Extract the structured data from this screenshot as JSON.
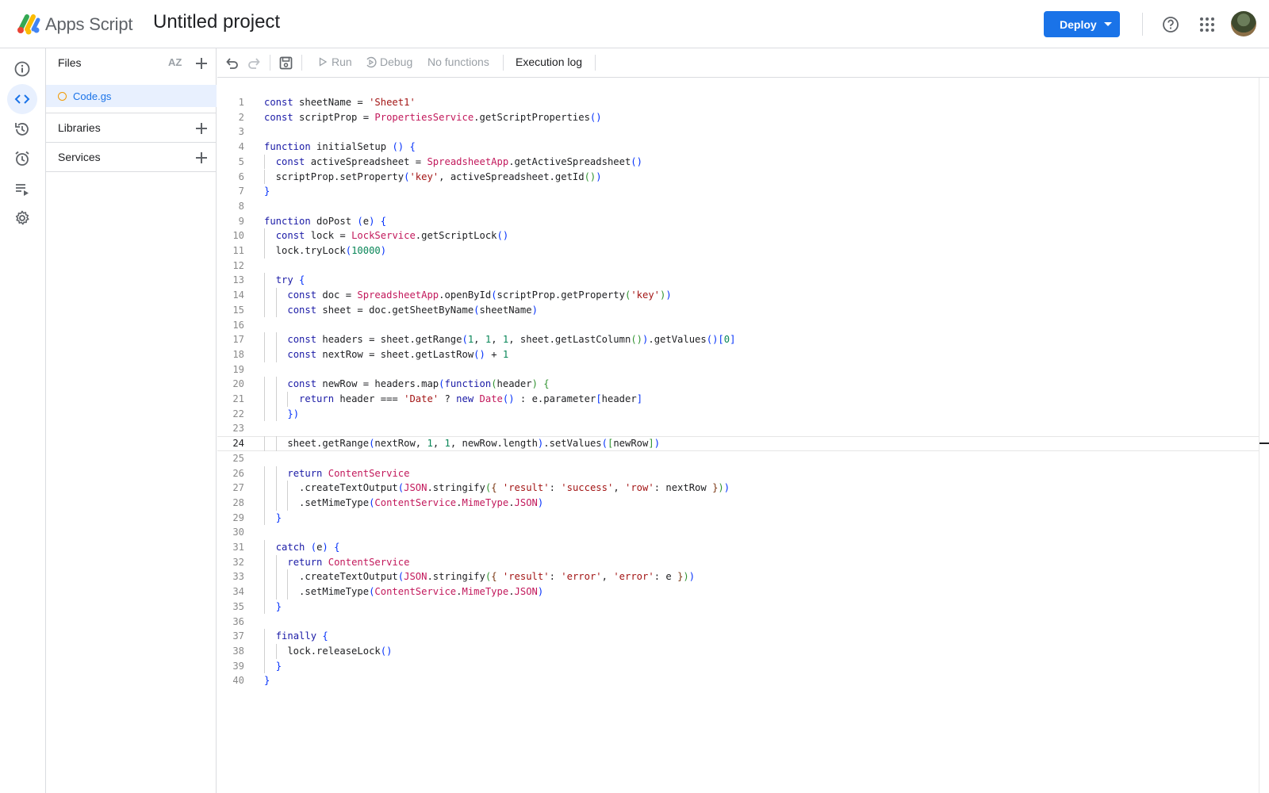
{
  "header": {
    "app_name": "Apps Script",
    "project_title": "Untitled project",
    "deploy_label": "Deploy"
  },
  "files_panel": {
    "title": "Files",
    "sort_label": "AZ",
    "files": [
      {
        "name": "Code.gs"
      }
    ],
    "sections": [
      {
        "label": "Libraries"
      },
      {
        "label": "Services"
      }
    ]
  },
  "toolbar": {
    "run_label": "Run",
    "debug_label": "Debug",
    "function_select": "No functions",
    "execution_log_label": "Execution log"
  },
  "rail": {
    "items": [
      "info-icon",
      "code-icon",
      "history-icon",
      "alarm-icon",
      "executions-icon",
      "settings-icon"
    ],
    "active": "code-icon"
  },
  "editor": {
    "current_line": 24,
    "lines": [
      "const sheetName = 'Sheet1'",
      "const scriptProp = PropertiesService.getScriptProperties()",
      "",
      "function initialSetup () {",
      "  const activeSpreadsheet = SpreadsheetApp.getActiveSpreadsheet()",
      "  scriptProp.setProperty('key', activeSpreadsheet.getId())",
      "}",
      "",
      "function doPost (e) {",
      "  const lock = LockService.getScriptLock()",
      "  lock.tryLock(10000)",
      "",
      "  try {",
      "    const doc = SpreadsheetApp.openById(scriptProp.getProperty('key'))",
      "    const sheet = doc.getSheetByName(sheetName)",
      "",
      "    const headers = sheet.getRange(1, 1, 1, sheet.getLastColumn()).getValues()[0]",
      "    const nextRow = sheet.getLastRow() + 1",
      "",
      "    const newRow = headers.map(function(header) {",
      "      return header === 'Date' ? new Date() : e.parameter[header]",
      "    })",
      "",
      "    sheet.getRange(nextRow, 1, 1, newRow.length).setValues([newRow])",
      "",
      "    return ContentService",
      "      .createTextOutput(JSON.stringify({ 'result': 'success', 'row': nextRow }))",
      "      .setMimeType(ContentService.MimeType.JSON)",
      "  }",
      "",
      "  catch (e) {",
      "    return ContentService",
      "      .createTextOutput(JSON.stringify({ 'result': 'error', 'error': e }))",
      "      .setMimeType(ContentService.MimeType.JSON)",
      "  }",
      "",
      "  finally {",
      "    lock.releaseLock()",
      "  }",
      "}"
    ]
  }
}
